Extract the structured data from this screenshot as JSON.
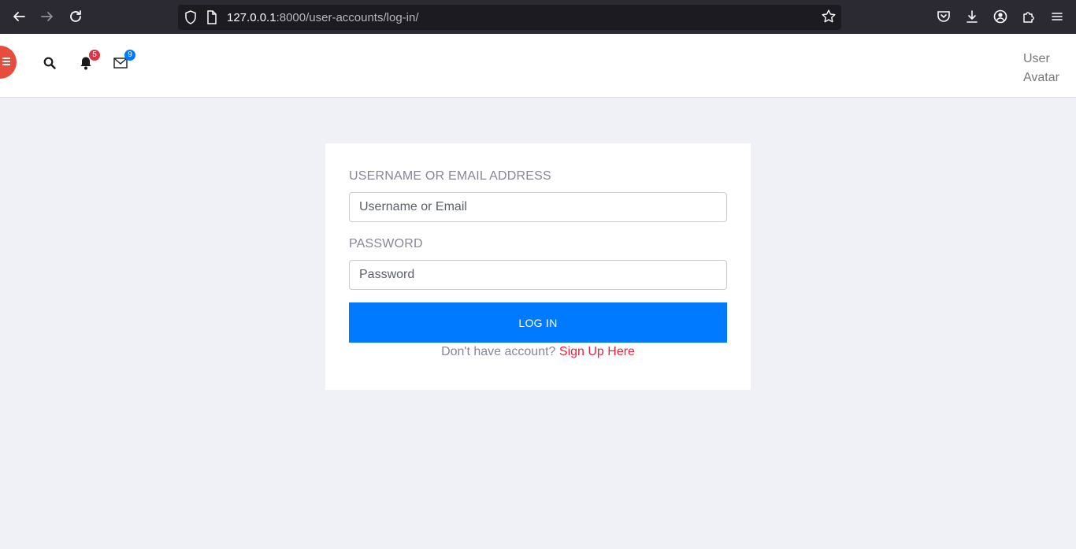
{
  "browser": {
    "url_host": "127.0.0.1",
    "url_rest": ":8000/user-accounts/log-in/",
    "icons": [
      "back-arrow-icon",
      "forward-arrow-icon",
      "reload-icon",
      "shield-icon",
      "page-icon",
      "bookmark-star-icon",
      "pocket-icon",
      "download-icon",
      "account-icon",
      "extensions-icon",
      "menu-icon"
    ]
  },
  "header": {
    "notifications_count": "5",
    "messages_count": "9",
    "user_avatar_label": "User Avatar",
    "colors": {
      "menu_toggle": "#e74c3c",
      "notification_badge": "#dc3545",
      "message_badge": "#007bff"
    }
  },
  "login": {
    "username_label": "USERNAME OR EMAIL ADDRESS",
    "username_placeholder": "Username or Email",
    "username_value": "",
    "password_label": "PASSWORD",
    "password_placeholder": "Password",
    "password_value": "",
    "submit_label": "LOG IN",
    "signup_prompt": "Don't have account?",
    "signup_link": "Sign Up Here",
    "colors": {
      "button": "#007bff",
      "link": "#e8233f",
      "page_bg": "#f0f1f6"
    }
  }
}
